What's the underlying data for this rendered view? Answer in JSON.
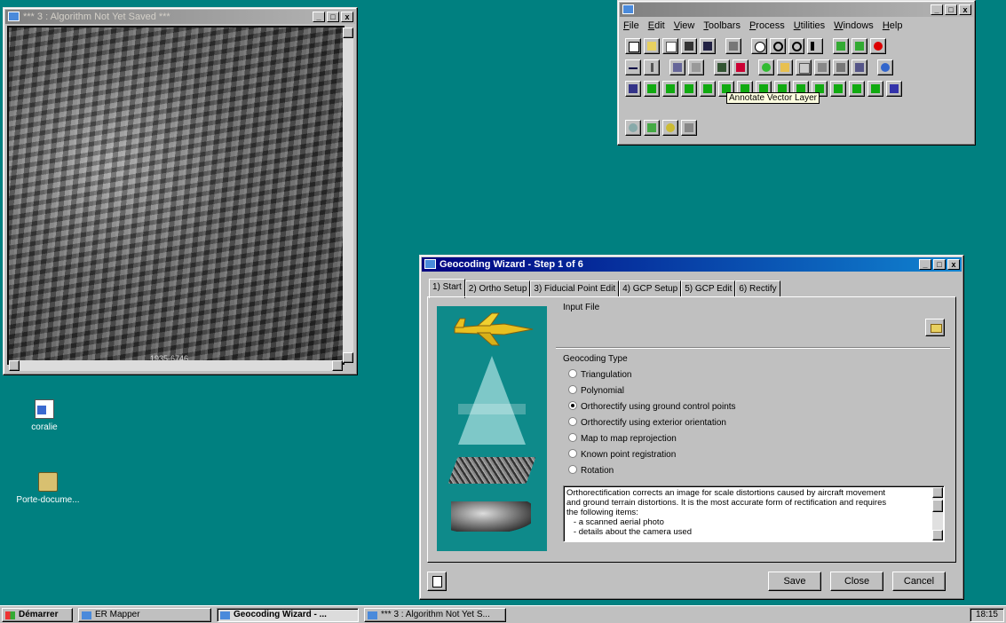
{
  "image_window": {
    "title": "*** 3 : Algorithm Not Yet Saved ***",
    "photo_id": "1935-6746",
    "controls": [
      "_",
      "□",
      "x"
    ]
  },
  "ermapper_window": {
    "menus": [
      "File",
      "Edit",
      "View",
      "Toolbars",
      "Process",
      "Utilities",
      "Windows",
      "Help"
    ],
    "tooltip": "Annotate Vector Layer"
  },
  "wizard": {
    "title": "Geocoding Wizard - Step 1 of 6",
    "tabs": [
      "1) Start",
      "2) Ortho Setup",
      "3) Fiducial Point Edit",
      "4) GCP Setup",
      "5) GCP Edit",
      "6) Rectify"
    ],
    "input_file_label": "Input File",
    "geocoding_type_label": "Geocoding Type",
    "options": [
      {
        "label": "Triangulation",
        "selected": false
      },
      {
        "label": "Polynomial",
        "selected": false
      },
      {
        "label": "Orthorectify using ground control points",
        "selected": true
      },
      {
        "label": "Orthorectify using exterior orientation",
        "selected": false
      },
      {
        "label": "Map to map reprojection",
        "selected": false
      },
      {
        "label": "Known point registration",
        "selected": false
      },
      {
        "label": "Rotation",
        "selected": false
      }
    ],
    "description_lines": [
      "Orthorectification corrects an image for scale distortions caused by aircraft movement",
      "and ground terrain distortions. It is the most accurate form of rectification and requires",
      "the following items:",
      "   - a scanned aerial photo",
      "   - details about the camera used"
    ],
    "buttons": {
      "save": "Save",
      "close": "Close",
      "cancel": "Cancel"
    }
  },
  "desktop_icons": [
    {
      "label": "coralie",
      "icon": "document-icon"
    },
    {
      "label": "Porte-docume...",
      "icon": "briefcase-icon"
    }
  ],
  "taskbar": {
    "start": "Démarrer",
    "tasks": [
      "ER Mapper",
      "Geocoding Wizard - ...",
      "*** 3 : Algorithm Not Yet S..."
    ],
    "clock": "18:15"
  },
  "colors": {
    "desktop": "#008080",
    "title_active": "#000080",
    "window": "#c0c0c0"
  }
}
